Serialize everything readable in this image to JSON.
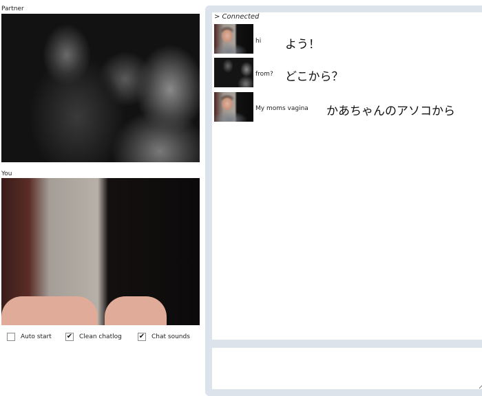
{
  "partner_label": "Partner",
  "you_label": "You",
  "options": [
    {
      "label": "Auto start",
      "checked": false
    },
    {
      "label": "Clean chatlog",
      "checked": true
    },
    {
      "label": "Chat sounds",
      "checked": true
    }
  ],
  "check_mark": "✔",
  "chat": {
    "status": "> Connected",
    "messages": [
      {
        "text": "hi",
        "translation": "よう！"
      },
      {
        "text": "from?",
        "translation": "どこから？"
      },
      {
        "text": "My moms vagina",
        "translation": "かあちゃんのアソコから"
      }
    ],
    "input_value": ""
  },
  "colors": {
    "panel_background": "#dde3ea",
    "page_background": "#ffffff"
  }
}
